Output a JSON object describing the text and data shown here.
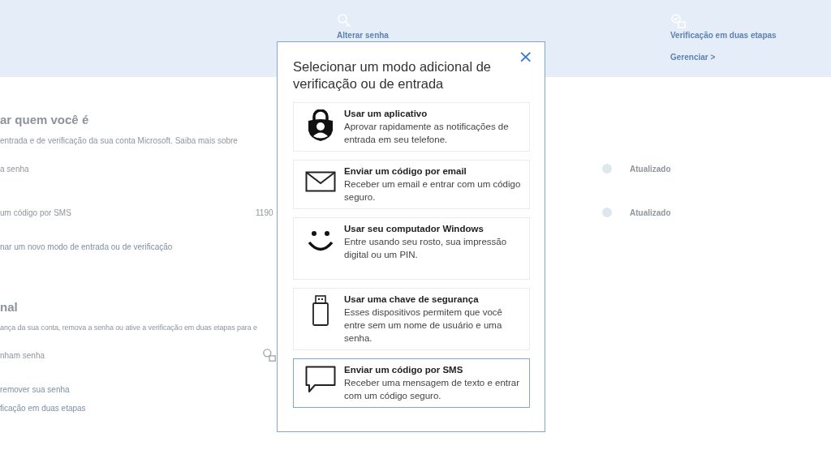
{
  "background_page": {
    "header_tabs": [
      {
        "label": "Alterar senha",
        "kind": "key"
      },
      {
        "label": "Verificação em duas etapas",
        "kind": "two_step",
        "link": "Gerenciar >"
      }
    ],
    "sections": [
      {
        "heading": "ar quem você é",
        "description": "entrada e de verificação da sua conta Microsoft. Saiba mais sobre",
        "rows": [
          {
            "name": "a senha",
            "status": "Atualizado"
          },
          {
            "name": "um código por SMS",
            "value": "1190",
            "status": "Atualizado"
          }
        ],
        "links": [
          "nar um novo modo de entrada ou de verificação"
        ]
      },
      {
        "heading": "nal",
        "description": "ança da sua conta, remova a senha ou ative a verificação em duas etapas para e",
        "rows": [
          {
            "name": "nham senha",
            "icon": true
          }
        ],
        "links": [
          "remover sua senha",
          "ficação em duas etapas"
        ]
      }
    ]
  },
  "dialog": {
    "title": "Selecionar um modo adicional de verificação ou de entrada",
    "close": "×",
    "options": [
      {
        "kind": "app",
        "title": "Usar um aplicativo",
        "description": "Aprovar rapidamente as notificações de entrada em seu telefone.",
        "selected": false
      },
      {
        "kind": "email",
        "title": "Enviar um código por email",
        "description": "Receber um email e entrar com um código seguro.",
        "selected": false
      },
      {
        "kind": "windows",
        "title": "Usar seu computador Windows",
        "description": "Entre usando seu rosto, sua impressão digital ou um PIN.",
        "selected": false
      },
      {
        "kind": "key",
        "title": "Usar uma chave de segurança",
        "description": "Esses dispositivos permitem que você entre sem um nome de usuário e uma senha.",
        "selected": false
      },
      {
        "kind": "sms",
        "title": "Enviar um código por SMS",
        "description": "Receber uma mensagem de texto e entrar com um código seguro.",
        "selected": true
      }
    ]
  }
}
